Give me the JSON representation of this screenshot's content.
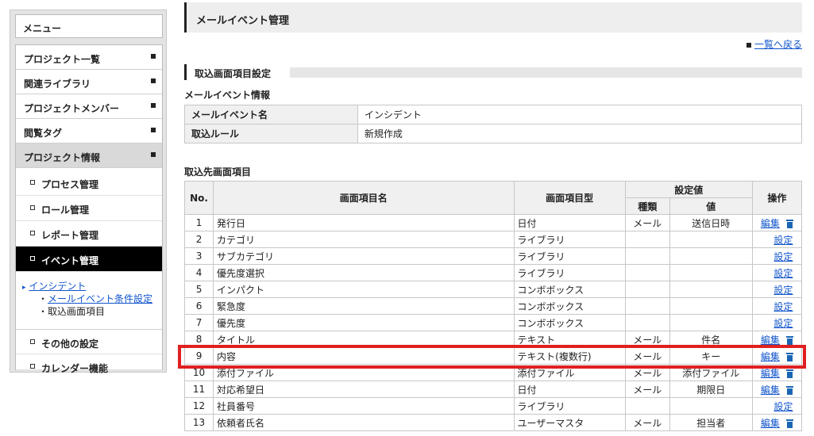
{
  "sidebar": {
    "title": "メニュー",
    "items": [
      {
        "label": "プロジェクト一覧"
      },
      {
        "label": "関連ライブラリ"
      },
      {
        "label": "プロジェクトメンバー"
      },
      {
        "label": "閲覧タグ"
      },
      {
        "label": "プロジェクト情報"
      }
    ],
    "sub_items": [
      {
        "label": "プロセス管理"
      },
      {
        "label": "ロール管理"
      },
      {
        "label": "レポート管理"
      },
      {
        "label": "イベント管理"
      }
    ],
    "tree": {
      "root_label": "インシデント",
      "child1_label": "メールイベント条件設定",
      "child2_label": "取込画面項目"
    },
    "bottom_items": [
      {
        "label": "その他の設定"
      },
      {
        "label": "カレンダー機能"
      }
    ]
  },
  "main": {
    "title": "メールイベント管理",
    "back_link": "一覧へ戻る",
    "section_title": "取込画面項目設定",
    "info_heading": "メールイベント情報",
    "info": [
      {
        "key": "メールイベント名",
        "value": "インシデント"
      },
      {
        "key": "取込ルール",
        "value": "新規作成"
      }
    ],
    "grid_heading": "取込先画面項目",
    "grid_headers": {
      "no": "No.",
      "name": "画面項目名",
      "type": "画面項目型",
      "setting": "設定値",
      "kind": "種類",
      "value": "値",
      "ops": "操作"
    },
    "op_labels": {
      "edit": "編集",
      "setting": "設定"
    },
    "rows": [
      {
        "no": "1",
        "name": "発行日",
        "type": "日付",
        "kind": "メール",
        "value": "送信日時",
        "op": "edit"
      },
      {
        "no": "2",
        "name": "カテゴリ",
        "type": "ライブラリ",
        "kind": "",
        "value": "",
        "op": "setting"
      },
      {
        "no": "3",
        "name": "サブカテゴリ",
        "type": "ライブラリ",
        "kind": "",
        "value": "",
        "op": "setting"
      },
      {
        "no": "4",
        "name": "優先度選択",
        "type": "ライブラリ",
        "kind": "",
        "value": "",
        "op": "setting"
      },
      {
        "no": "5",
        "name": "インパクト",
        "type": "コンボボックス",
        "kind": "",
        "value": "",
        "op": "setting"
      },
      {
        "no": "6",
        "name": "緊急度",
        "type": "コンボボックス",
        "kind": "",
        "value": "",
        "op": "setting"
      },
      {
        "no": "7",
        "name": "優先度",
        "type": "コンボボックス",
        "kind": "",
        "value": "",
        "op": "setting"
      },
      {
        "no": "8",
        "name": "タイトル",
        "type": "テキスト",
        "kind": "メール",
        "value": "件名",
        "op": "edit"
      },
      {
        "no": "9",
        "name": "内容",
        "type": "テキスト(複数行)",
        "kind": "メール",
        "value": "キー",
        "op": "edit"
      },
      {
        "no": "10",
        "name": "添付ファイル",
        "type": "添付ファイル",
        "kind": "メール",
        "value": "添付ファイル",
        "op": "edit"
      },
      {
        "no": "11",
        "name": "対応希望日",
        "type": "日付",
        "kind": "メール",
        "value": "期限日",
        "op": "edit"
      },
      {
        "no": "12",
        "name": "社員番号",
        "type": "ライブラリ",
        "kind": "",
        "value": "",
        "op": "setting"
      },
      {
        "no": "13",
        "name": "依頼者氏名",
        "type": "ユーザーマスタ",
        "kind": "メール",
        "value": "担当者",
        "op": "edit"
      }
    ]
  },
  "colors": {
    "highlight": "#e02020",
    "link": "#1155cc",
    "active_bg": "#000000"
  }
}
